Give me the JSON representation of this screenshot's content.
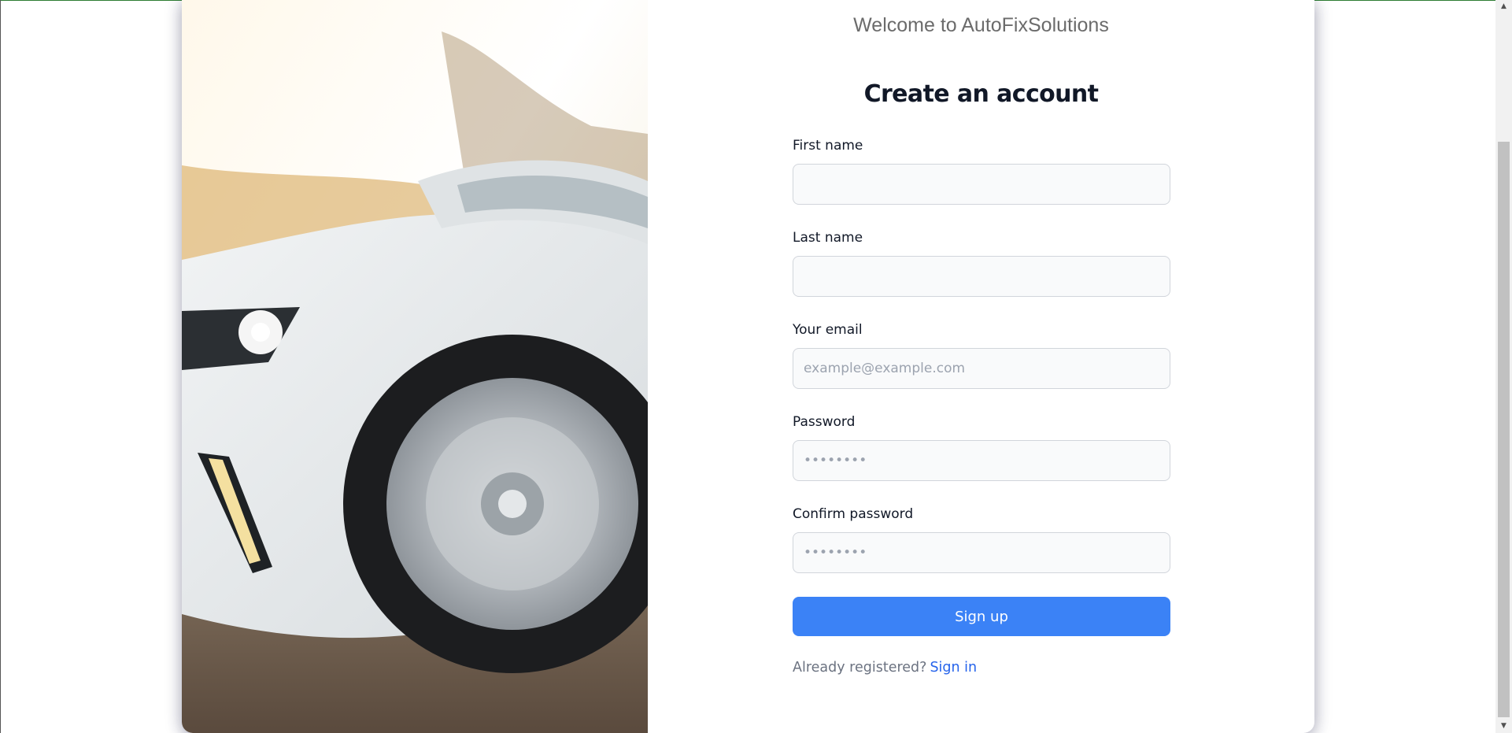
{
  "header": {
    "welcome": "Welcome to AutoFixSolutions"
  },
  "form": {
    "title": "Create an account",
    "first_name": {
      "label": "First name",
      "value": "",
      "placeholder": ""
    },
    "last_name": {
      "label": "Last name",
      "value": "",
      "placeholder": ""
    },
    "email": {
      "label": "Your email",
      "value": "",
      "placeholder": "example@example.com"
    },
    "password": {
      "label": "Password",
      "placeholder": "••••••••"
    },
    "confirm_password": {
      "label": "Confirm password",
      "placeholder": "••••••••"
    },
    "submit_label": "Sign up",
    "signin_prompt": "Already registered?",
    "signin_link": "Sign in"
  },
  "colors": {
    "primary_button": "#3b82f6",
    "link": "#2563eb",
    "field_background": "#f9fafb"
  },
  "icons": {
    "scroll_up": "arrow-up-icon",
    "scroll_down": "arrow-down-icon"
  }
}
